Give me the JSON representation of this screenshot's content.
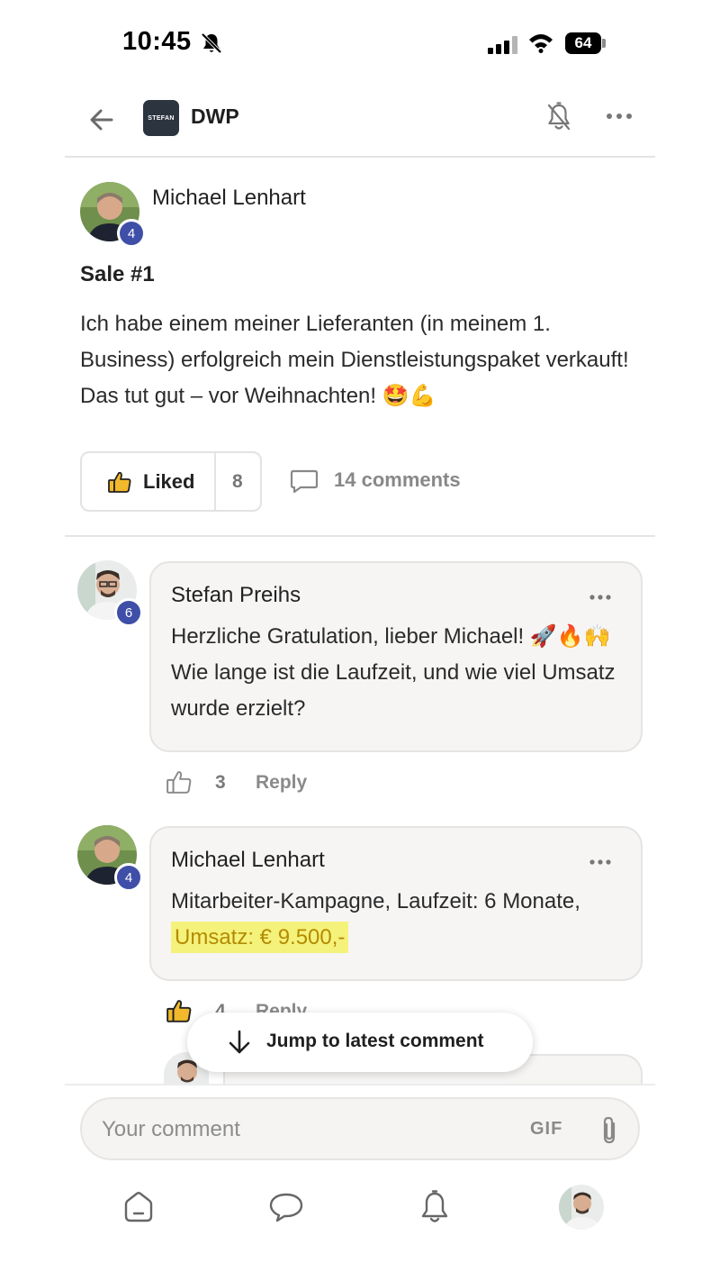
{
  "status_bar": {
    "time": "10:45",
    "battery": "64"
  },
  "header": {
    "group_name": "DWP",
    "logo_text": "STEFAN"
  },
  "post": {
    "author": "Michael Lenhart",
    "author_level": "4",
    "title": "Sale #1",
    "body": "Ich habe einem meiner Lieferanten (in meinem 1. Business) erfolgreich mein Dienstleistungspaket verkauft! Das tut gut – vor Weihnachten! 🤩💪",
    "like_label": "Liked",
    "like_count": "8",
    "comments_label": "14 comments"
  },
  "comments": [
    {
      "author": "Stefan Preihs",
      "level": "6",
      "text": "Herzliche Gratulation, lieber Michael! 🚀🔥🙌 Wie lange ist die Laufzeit, und wie viel Umsatz wurde erzielt?",
      "likes": "3",
      "reply_label": "Reply"
    },
    {
      "author": "Michael Lenhart",
      "level": "4",
      "text_before": "Mitarbeiter-Kampagne, Laufzeit: 6 Monate,",
      "text_highlight": "Umsatz: € 9.500,-",
      "likes": "4",
      "reply_label": "Reply"
    }
  ],
  "jump_button": {
    "label": "Jump to latest comment"
  },
  "composer": {
    "placeholder": "Your comment",
    "gif_label": "GIF"
  },
  "colors": {
    "badge": "#3f4fa8",
    "highlight": "#f5f27c",
    "accent_like": "#f2b92c"
  }
}
